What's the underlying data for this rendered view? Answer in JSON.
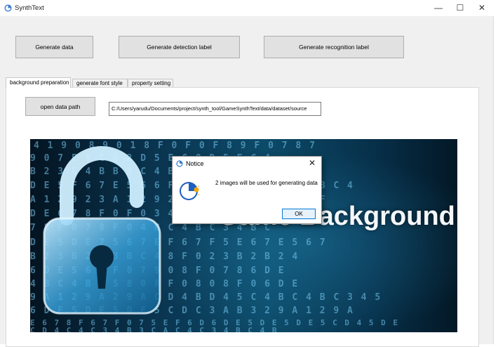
{
  "window": {
    "title": "SynthText",
    "controls": {
      "minimize": "—",
      "maximize": "☐",
      "close": "✕"
    },
    "icon": "app-logo-icon"
  },
  "toolbar": {
    "generate_data_label": "Generate data",
    "generate_detection_label": "Generate detection label",
    "generate_recognition_label": "Generate recognition label"
  },
  "tabs": [
    {
      "label": "background preparation",
      "active": true
    },
    {
      "label": "generate font style",
      "active": false
    },
    {
      "label": "property setting",
      "active": false
    }
  ],
  "background_tab": {
    "open_path_label": "open data path",
    "path_value": "C:/Users/yarudu/Documents/project/synth_tool/GameSynthText/data/dataset/source",
    "image_title": "Game Background",
    "hex_rows": [
      "4 1 9   0 8 9 0 1 8 F 0 F 0    F   8 9   F 0 7 8   7",
      "9 0 7 E 9       C D 2   D 5 E C     8 D 5 E C   4",
      "B 2 3 C 4 B     B 3 C 4 B   F 6 7 F 5     9 0 8",
      "D E 5 F 6 7 E 5 6   6   F 6   7 F     C D 4 B C D 4 B C 4",
      "A 1 2 9   2 3 A 1 2 9   2 9 0 8     E 5 D E 5 D C   F",
      "D E   6 7 8 F 0 F 0   3 4 B 7 8 F 0 7 8   6 D E",
      "  7 8 F 0 7 8 F 0     4 B C 4 B C     3 4 B C",
      "D E 5 D E 7 5 6 7 E     F 6 7 F 5   E 6 7 E 5 6 7",
      "B 2 3 B 2   2 3 B   C 4   8 F 0   2 3 B 2   B 2   4",
      "  6 D E 5   6 7 F 0 7     9 0 8 F 0 7 8     6 D E",
      "4 B C 4 B C 5     8   0   8 F 0 8   0 8 F 0   6 D E",
      "  9 A 1 2 9 A 2 9 A C D 4 B D 4 5 C   4 B C 4 B C 3 4 5",
      "6 D E 5 D E 5 D E 5 C D C 3 A B   3     2 9 A 1 2 9 A",
      "  E 6 7 8 F 6 7 F 0 7 5   E F 6 D   6 D E 5 D E   5 D E 5 C D 4 5 D E",
      "C D 4 C   4 C 3 4 B 3   C A C   4 C 3 4 B   C 4 B"
    ]
  },
  "dialog": {
    "title": "Notice",
    "message": "2 images will be used for generating data",
    "ok_label": "OK",
    "close_glyph": "✕"
  },
  "colors": {
    "window_bg": "#f0f0f0",
    "button_bg": "#e1e1e1",
    "accent": "#0078d7",
    "image_dark": "#041421",
    "image_glow": "#4db8f0"
  }
}
